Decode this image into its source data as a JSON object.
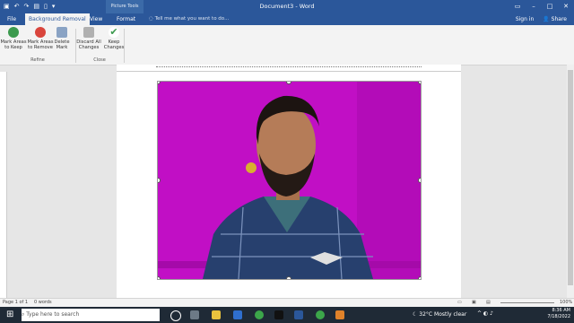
{
  "titlebar": {
    "doc_title": "Document3 - Word",
    "picture_tools": "Picture Tools"
  },
  "tabs": {
    "file": "File",
    "background_removal": "Background Removal",
    "view": "View",
    "format": "Format",
    "tell": "Tell me what you want to do...",
    "sign_in": "Sign in",
    "share": "Share"
  },
  "ribbon": {
    "mark_keep": "Mark Areas to Keep",
    "mark_remove": "Mark Areas to Remove",
    "delete_mark": "Delete Mark",
    "discard": "Discard All Changes",
    "keep": "Keep Changes",
    "group_refine": "Refine",
    "group_close": "Close"
  },
  "status": {
    "page": "Page 1 of 1",
    "words": "0 words",
    "zoom": "100%"
  },
  "taskbar": {
    "search_placeholder": "Type here to search",
    "temp": "32°C",
    "weather": "Mostly clear",
    "time": "8:36 AM",
    "date": "7/18/2022"
  },
  "colors": {
    "accent": "#2b579a",
    "photo_bg": "#c10fc5"
  }
}
